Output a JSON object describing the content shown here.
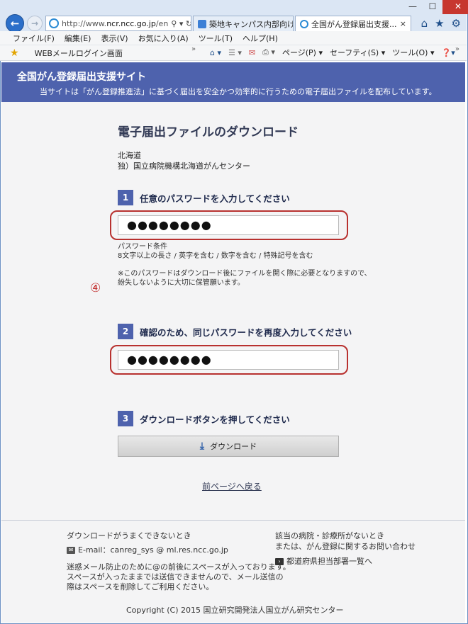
{
  "browser": {
    "address_url_prefix": "http://www.",
    "address_url_domain": "ncr.ncc.go.jp",
    "address_url_suffix": "/en",
    "address_controls": "⚲ ▾ ↻",
    "tabs": [
      {
        "label": "築地キャンパス内部向けサー...",
        "active": false
      },
      {
        "label": "全国がん登録届出支援...",
        "active": true
      }
    ],
    "tab_close": "×",
    "menu": [
      "ファイル(F)",
      "編集(E)",
      "表示(V)",
      "お気に入り(A)",
      "ツール(T)",
      "ヘルプ(H)"
    ],
    "favorites": {
      "link": "WEBメールログイン画面"
    },
    "command_bar": [
      "ページ(P) ▾",
      "セーフティ(S) ▾",
      "ツール(O) ▾"
    ],
    "window_controls": {
      "minimize": "—",
      "maximize": "☐",
      "close": "✕"
    },
    "colors": {
      "accent": "#4e62ad",
      "highlight": "#b8312f"
    }
  },
  "site": {
    "title": "全国がん登録届出支援サイト",
    "subtitle": "当サイトは「がん登録推進法」に基づく届出を安全かつ効率的に行うための電子届出ファイルを配布しています。"
  },
  "main": {
    "heading": "電子届出ファイルのダウンロード",
    "org_line1": "北海道",
    "org_line2": "独）国立病院機構北海道がんセンター",
    "step1": {
      "num": "1",
      "label": "任意のパスワードを入力してください",
      "value": "●●●●●●●●"
    },
    "conditions_title": "パスワード条件",
    "conditions_text": "8文字以上の長さ / 英字を含む / 数字を含む / 特殊記号を含む",
    "note_line1": "※このパスワードはダウンロード後にファイルを開く際に必要となりますので、",
    "note_line2": "紛失しないように大切に保管願います。",
    "marker": "④",
    "step2": {
      "num": "2",
      "label": "確認のため、同じパスワードを再度入力してください",
      "value": "●●●●●●●●"
    },
    "step3": {
      "num": "3",
      "label": "ダウンロードボタンを押してください"
    },
    "download_label": "ダウンロード",
    "back_link": "前ページへ戻る"
  },
  "footer": {
    "trouble_title": "ダウンロードがうまくできないとき",
    "email": "E-mail：canreg_sys @ ml.res.ncc.go.jp",
    "spam_line1": "迷惑メール防止のために@の前後にスペースが入っております。",
    "spam_line2": "スペースが入ったままでは送信できませんので、メール送信の",
    "spam_line3": "際はスペースを削除してご利用ください。",
    "hospital_line1": "該当の病院・診療所がないとき",
    "hospital_line2": "または、がん登録に関するお問い合わせ",
    "prefecture_link": "都道府県担当部署一覧へ",
    "copyright": "Copyright (C) 2015 国立研究開発法人国立がん研究センター"
  }
}
